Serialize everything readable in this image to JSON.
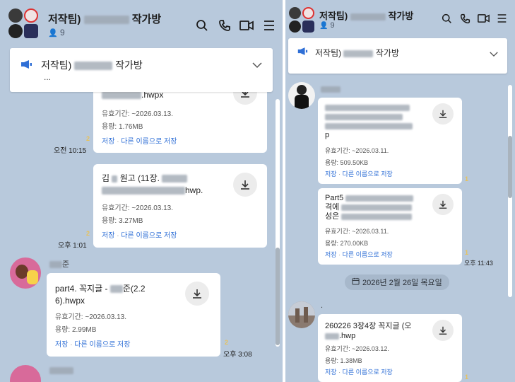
{
  "left": {
    "header": {
      "title_prefix": "저작팀)",
      "title_suffix": "작가방",
      "member_count": "9"
    },
    "notice": {
      "title_prefix": "저작팀)",
      "title_suffix": "작가방",
      "snippet": "..."
    },
    "messages": [
      {
        "file_name_line1_suffix": ".hwpx",
        "expiry": "유효기간: ~2026.03.13.",
        "size": "용량: 1.76MB",
        "save": "저장",
        "save_as": "다른 이름으로 저장",
        "unread": "2",
        "time": "오전 10:15"
      },
      {
        "file_name_line1_prefix": "김",
        "file_name_line1_mid": "원고 (11장.",
        "file_name_line2_suffix": "hwp.",
        "expiry": "유효기간: ~2026.03.13.",
        "size": "용량: 3.27MB",
        "save": "저장",
        "save_as": "다른 이름으로 저장",
        "unread": "2",
        "time": "오후 1:01"
      },
      {
        "sender_suffix": "준",
        "file_name_line1_prefix": "part4. 꼭지글 -",
        "file_name_line1_suffix": "준(2.2",
        "file_name_line2": "6).hwpx",
        "expiry": "유효기간: ~2026.03.13.",
        "size": "용량: 2.99MB",
        "save": "저장",
        "save_as": "다른 이름으로 저장",
        "unread": "2",
        "time": "오후 3:08"
      }
    ]
  },
  "right": {
    "header": {
      "title_prefix": "저작팀)",
      "title_suffix": "작가방",
      "member_count": "9"
    },
    "notice": {
      "title_prefix": "저작팀)",
      "title_suffix": "작가방"
    },
    "messages": [
      {
        "file_name_last": "p",
        "expiry": "유효기간: ~2026.03.11.",
        "size": "용량: 509.50KB",
        "save": "저장",
        "save_as": "다른 이름으로 저장",
        "unread": "1"
      },
      {
        "file_name_line1_prefix": "Part5",
        "file_name_line2_prefix": "격에",
        "file_name_line3_prefix": "성은",
        "expiry": "유효기간: ~2026.03.11.",
        "size": "용량: 270.00KB",
        "save": "저장",
        "save_as": "다른 이름으로 저장",
        "unread": "1",
        "time": "오후 11:43"
      },
      {
        "sender": ".",
        "file_name_line1": "260226 3장4장 꼭지글 (오",
        "file_name_line2_suffix": ".hwp",
        "expiry": "유효기간: ~2026.03.12.",
        "size": "용량: 1.38MB",
        "save": "저장",
        "save_as": "다른 이름으로 저장",
        "unread": "1"
      }
    ],
    "date_divider": "2026년 2월 26일 목요일"
  },
  "icons": {
    "search": "search-icon",
    "call": "phone-icon",
    "video": "video-icon",
    "menu": "menu-icon",
    "notice": "megaphone-icon",
    "expand": "chevron-down-icon",
    "download": "download-icon",
    "member": "person-icon",
    "calendar": "calendar-icon"
  },
  "colors": {
    "background": "#b8c9dc",
    "link": "#2f6fd6",
    "unread": "#e8c25a",
    "notice_icon": "#2f6fd6"
  }
}
